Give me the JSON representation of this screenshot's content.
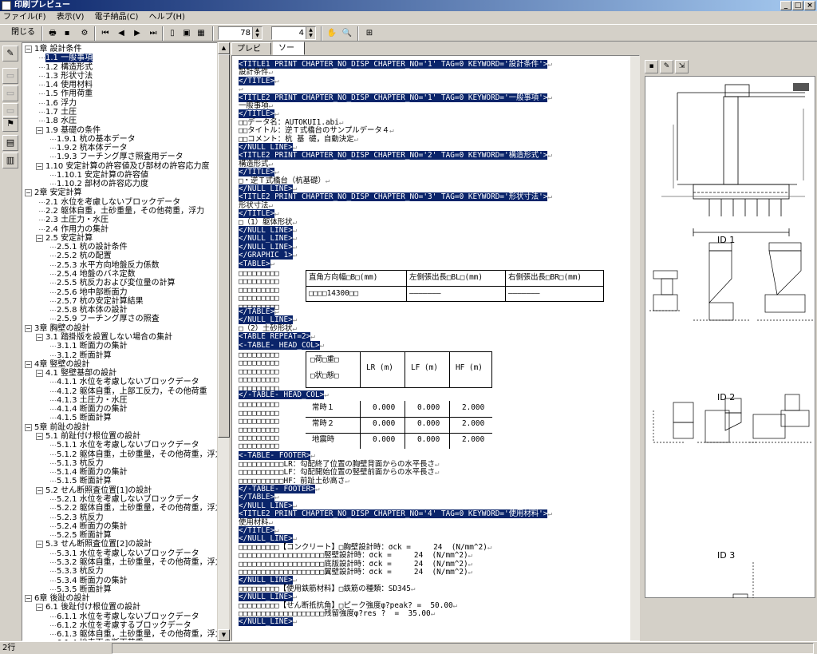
{
  "window": {
    "title": "印刷プレビュー"
  },
  "menu": [
    "ファイル(F)",
    "表示(V)",
    "電子納品(C)",
    "ヘルプ(H)"
  ],
  "toolbar": {
    "close_label": "閉じる",
    "page_value": "78",
    "zoom_value": "4"
  },
  "tabs": [
    "プレビュー",
    "ソース"
  ],
  "tree": [
    {
      "label": "1章 設計条件",
      "lvl": 0,
      "box": "−"
    },
    {
      "label": "1.1 一般事項",
      "lvl": 1,
      "sel": true
    },
    {
      "label": "1.2 構造形式",
      "lvl": 1
    },
    {
      "label": "1.3 形状寸法",
      "lvl": 1
    },
    {
      "label": "1.4 使用材料",
      "lvl": 1
    },
    {
      "label": "1.5 作用荷重",
      "lvl": 1
    },
    {
      "label": "1.6 浮力",
      "lvl": 1
    },
    {
      "label": "1.7 土圧",
      "lvl": 1
    },
    {
      "label": "1.8 水圧",
      "lvl": 1
    },
    {
      "label": "1.9 基礎の条件",
      "lvl": 1,
      "box": "−"
    },
    {
      "label": "1.9.1 杭の基本データ",
      "lvl": 2
    },
    {
      "label": "1.9.2 杭本体データ",
      "lvl": 2
    },
    {
      "label": "1.9.3 フーチング厚さ照査用データ",
      "lvl": 2
    },
    {
      "label": "1.10 安定計算の許容値及び部材の許容応力度",
      "lvl": 1,
      "box": "−"
    },
    {
      "label": "1.10.1 安定計算の許容値",
      "lvl": 2
    },
    {
      "label": "1.10.2 部材の許容応力度",
      "lvl": 2
    },
    {
      "label": "2章 安定計算",
      "lvl": 0,
      "box": "−"
    },
    {
      "label": "2.1 水位を考慮しないブロックデータ",
      "lvl": 1
    },
    {
      "label": "2.2 躯体自重，土砂重量，その他荷重，浮力",
      "lvl": 1
    },
    {
      "label": "2.3 土圧力・水圧",
      "lvl": 1
    },
    {
      "label": "2.4 作用力の集計",
      "lvl": 1
    },
    {
      "label": "2.5 安定計算",
      "lvl": 1,
      "box": "−"
    },
    {
      "label": "2.5.1 杭の設計条件",
      "lvl": 2
    },
    {
      "label": "2.5.2 杭の配置",
      "lvl": 2
    },
    {
      "label": "2.5.3 水平方向地盤反力係数",
      "lvl": 2
    },
    {
      "label": "2.5.4 地盤のバネ定数",
      "lvl": 2
    },
    {
      "label": "2.5.5 杭反力および変位量の計算",
      "lvl": 2
    },
    {
      "label": "2.5.6 地中部断面力",
      "lvl": 2
    },
    {
      "label": "2.5.7 杭の安定計算結果",
      "lvl": 2
    },
    {
      "label": "2.5.8 杭本体の設計",
      "lvl": 2
    },
    {
      "label": "2.5.9 フーチング厚さの照査",
      "lvl": 2
    },
    {
      "label": "3章 胸壁の設計",
      "lvl": 0,
      "box": "−"
    },
    {
      "label": "3.1 踏掛版を設置しない場合の集計",
      "lvl": 1,
      "box": "−"
    },
    {
      "label": "3.1.1 断面力の集計",
      "lvl": 2
    },
    {
      "label": "3.1.2 断面計算",
      "lvl": 2
    },
    {
      "label": "4章 竪壁の設計",
      "lvl": 0,
      "box": "−"
    },
    {
      "label": "4.1 竪壁基部の設計",
      "lvl": 1,
      "box": "−"
    },
    {
      "label": "4.1.1 水位を考慮しないブロックデータ",
      "lvl": 2
    },
    {
      "label": "4.1.2 躯体自重，上部工反力，その他荷重",
      "lvl": 2
    },
    {
      "label": "4.1.3 土圧力・水圧",
      "lvl": 2
    },
    {
      "label": "4.1.4 断面力の集計",
      "lvl": 2
    },
    {
      "label": "4.1.5 断面計算",
      "lvl": 2
    },
    {
      "label": "5章 前趾の設計",
      "lvl": 0,
      "box": "−"
    },
    {
      "label": "5.1 前趾付け根位置の設計",
      "lvl": 1,
      "box": "−"
    },
    {
      "label": "5.1.1 水位を考慮しないブロックデータ",
      "lvl": 2
    },
    {
      "label": "5.1.2 躯体自重，土砂重量，その他荷重，浮力",
      "lvl": 2
    },
    {
      "label": "5.1.3 杭反力",
      "lvl": 2
    },
    {
      "label": "5.1.4 断面力の集計",
      "lvl": 2
    },
    {
      "label": "5.1.5 断面計算",
      "lvl": 2
    },
    {
      "label": "5.2 せん断照査位置[1]の設計",
      "lvl": 1,
      "box": "−"
    },
    {
      "label": "5.2.1 水位を考慮しないブロックデータ",
      "lvl": 2
    },
    {
      "label": "5.2.2 躯体自重，土砂重量，その他荷重，浮力",
      "lvl": 2
    },
    {
      "label": "5.2.3 杭反力",
      "lvl": 2
    },
    {
      "label": "5.2.4 断面力の集計",
      "lvl": 2
    },
    {
      "label": "5.2.5 断面計算",
      "lvl": 2
    },
    {
      "label": "5.3 せん断照査位置[2]の設計",
      "lvl": 1,
      "box": "−"
    },
    {
      "label": "5.3.1 水位を考慮しないブロックデータ",
      "lvl": 2
    },
    {
      "label": "5.3.2 躯体自重，土砂重量，その他荷重，浮力",
      "lvl": 2
    },
    {
      "label": "5.3.3 杭反力",
      "lvl": 2
    },
    {
      "label": "5.3.4 断面力の集計",
      "lvl": 2
    },
    {
      "label": "5.3.5 断面計算",
      "lvl": 2
    },
    {
      "label": "6章 後趾の設計",
      "lvl": 0,
      "box": "−"
    },
    {
      "label": "6.1 後趾付け根位置の設計",
      "lvl": 1,
      "box": "−"
    },
    {
      "label": "6.1.1 水位を考慮しないブロックデータ",
      "lvl": 2
    },
    {
      "label": "6.1.2 水位を考慮するブロックデータ",
      "lvl": 2
    },
    {
      "label": "6.1.3 躯体自重，土砂重量，その他荷重，浮力",
      "lvl": 2
    },
    {
      "label": "6.1.4 地表面の断面荷重",
      "lvl": 2
    }
  ],
  "source_lines": [
    {
      "t": "<TITLE1 PRINT CHAPTER_NO_DISP CHAPTER_NO='1' TAG=0 KEYWORD='設計条件'>",
      "tag": true
    },
    {
      "t": "設計条件"
    },
    {
      "t": "</TITLE>",
      "tag": true
    },
    {
      "t": ""
    },
    {
      "t": "<TITLE2 PRINT CHAPTER_NO_DISP CHAPTER_NO='1' TAG=0 KEYWORD='一般事項'>",
      "tag": true
    },
    {
      "t": "一般事項"
    },
    {
      "t": "</TITLE>",
      "tag": true
    },
    {
      "t": "□□データ名：AUTOKUI1.abi"
    },
    {
      "t": "□□タイトル：逆Ｔ式橋台のサンプルデータ４"
    },
    {
      "t": "□□コメント：杭 基 礎，自動決定"
    },
    {
      "t": "</NULL_LINE>",
      "tag": true
    },
    {
      "t": "<TITLE2 PRINT CHAPTER_NO_DISP CHAPTER_NO='2' TAG=0 KEYWORD='構造形式'>",
      "tag": true
    },
    {
      "t": "構造形式"
    },
    {
      "t": "</TITLE>",
      "tag": true
    },
    {
      "t": "□・逆Ｔ式橋台（杭基礎）"
    },
    {
      "t": "</NULL_LINE>",
      "tag": true
    },
    {
      "t": "<TITLE2 PRINT CHAPTER_NO_DISP CHAPTER_NO='3' TAG=0 KEYWORD='形状寸法'>",
      "tag": true
    },
    {
      "t": "形状寸法"
    },
    {
      "t": "</TITLE>",
      "tag": true
    },
    {
      "t": "□（1）躯体形状"
    },
    {
      "t": "</NULL_LINE>",
      "tag": true
    },
    {
      "t": "</NULL_LINE>",
      "tag": true
    },
    {
      "t": "</NULL_LINE>",
      "tag": true
    },
    {
      "t": "</GRAPHIC 1>",
      "tag": true
    },
    {
      "t": "<TABLE>",
      "tag": true
    }
  ],
  "table1": {
    "headers": [
      "直角方向幅□B□(mm)",
      "左側張出長□BL□(mm)",
      "右側張出長□BR□(mm)"
    ],
    "row": [
      "□□□□14300□□",
      "―――――――",
      "―――――――"
    ]
  },
  "source_lines2": [
    {
      "t": "</TABLE>",
      "tag": true
    },
    {
      "t": "</NULL_LINE>",
      "tag": true
    },
    {
      "t": "□（2）土砂形状"
    },
    {
      "t": "<TABLE REPEAT=2>",
      "tag": true
    },
    {
      "t": "<-TABLE- HEAD_COL>",
      "tag": true
    }
  ],
  "table2": {
    "headers": [
      "□荷□重□\n□状□態□",
      "LR (m)",
      "LF (m)",
      "HF (m)"
    ],
    "rows": [
      [
        "常時１",
        "0.000",
        "0.000",
        "2.000"
      ],
      [
        "常時２",
        "0.000",
        "0.000",
        "2.000"
      ],
      [
        "地震時",
        "0.000",
        "0.000",
        "2.000"
      ]
    ],
    "head_close": "</-TABLE- HEAD_COL>"
  },
  "source_lines3": [
    {
      "t": "<-TABLE- FOOTER>",
      "tag": true
    },
    {
      "t": "□□□□□□□□□□LR：勾配終了位置の胸壁背面からの水平長さ"
    },
    {
      "t": "□□□□□□□□□□LF：勾配開始位置の竪壁前面からの水平長さ"
    },
    {
      "t": "□□□□□□□□□□HF：前趾土砂高さ"
    },
    {
      "t": "</-TABLE- FOOTER>",
      "tag": true
    },
    {
      "t": "</TABLE>",
      "tag": true
    },
    {
      "t": "</NULL_LINE>",
      "tag": true
    },
    {
      "t": "<TITLE2 PRINT CHAPTER_NO_DISP CHAPTER_NO='4' TAG=0 KEYWORD='使用材料'>",
      "tag": true
    },
    {
      "t": "使用材料"
    },
    {
      "t": "</TITLE>",
      "tag": true
    },
    {
      "t": "</NULL_LINE>",
      "tag": true
    },
    {
      "t": "□□□□□□□□□【コンクリート】□胸壁設計時：σck =     24  (N/mm^2)"
    },
    {
      "t": "□□□□□□□□□□□□□□□□□□□竪壁設計時：σck =     24  (N/mm^2)"
    },
    {
      "t": "□□□□□□□□□□□□□□□□□□□底版設計時：σck =     24  (N/mm^2)"
    },
    {
      "t": "□□□□□□□□□□□□□□□□□□□翼壁設計時：σck =     24  (N/mm^2)"
    },
    {
      "t": "</NULL_LINE>",
      "tag": true
    },
    {
      "t": "□□□□□□□□□【使用鉄筋材料】□鉄筋の種類：SD345"
    },
    {
      "t": "</NULL_LINE>",
      "tag": true
    },
    {
      "t": "□□□□□□□□□【せん断抵抗角】□ピーク強度φ?peak? =  50.00"
    },
    {
      "t": "□□□□□□□□□□□□□□□□□□□残留強度φ?res ?  =  35.00"
    },
    {
      "t": "</NULL_LINE>",
      "tag": true
    }
  ],
  "preview": {
    "ids": [
      "ID 1",
      "ID 2",
      "ID 3"
    ]
  },
  "status": {
    "text": "2行"
  }
}
